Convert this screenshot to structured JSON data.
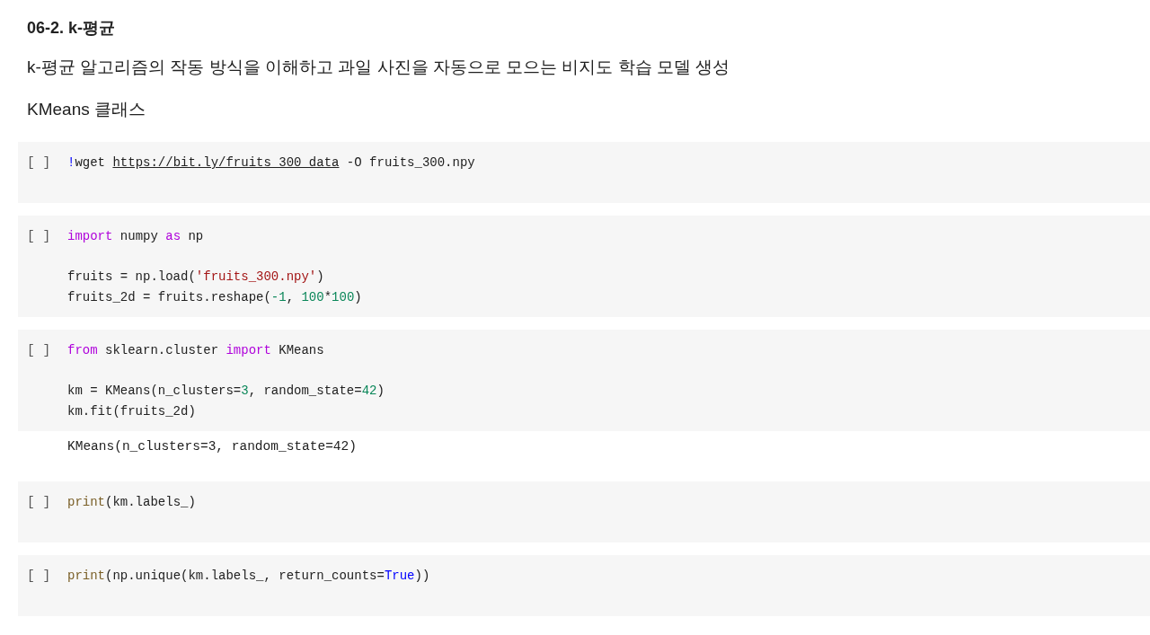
{
  "heading": "06-2. k-평균",
  "subtitle": "k-평균 알고리즘의 작동 방식을 이해하고 과일 사진을 자동으로 모으는 비지도 학습 모델 생성",
  "section": "KMeans 클래스",
  "cells": [
    {
      "prompt": "[ ]",
      "blocks": [
        [
          [
            {
              "kind": "magic",
              "text": "!"
            },
            {
              "kind": "plain",
              "text": "wget "
            },
            {
              "kind": "link",
              "text": "https://bit.ly/fruits_300_data"
            },
            {
              "kind": "plain",
              "text": " -O fruits_300.npy"
            }
          ]
        ]
      ]
    },
    {
      "prompt": "[ ]",
      "blocks": [
        [
          [
            {
              "kind": "keyword",
              "text": "import"
            },
            {
              "kind": "plain",
              "text": " numpy "
            },
            {
              "kind": "keyword",
              "text": "as"
            },
            {
              "kind": "plain",
              "text": " np"
            }
          ]
        ],
        [
          [
            {
              "kind": "plain",
              "text": "fruits = np.load("
            },
            {
              "kind": "string",
              "text": "'fruits_300.npy'"
            },
            {
              "kind": "plain",
              "text": ")"
            }
          ],
          [
            {
              "kind": "plain",
              "text": "fruits_2d = fruits.reshape("
            },
            {
              "kind": "number",
              "text": "-1"
            },
            {
              "kind": "plain",
              "text": ", "
            },
            {
              "kind": "number",
              "text": "100"
            },
            {
              "kind": "plain",
              "text": "*"
            },
            {
              "kind": "number",
              "text": "100"
            },
            {
              "kind": "plain",
              "text": ")"
            }
          ]
        ]
      ]
    },
    {
      "prompt": "[ ]",
      "blocks": [
        [
          [
            {
              "kind": "keyword",
              "text": "from"
            },
            {
              "kind": "plain",
              "text": " sklearn.cluster "
            },
            {
              "kind": "keyword",
              "text": "import"
            },
            {
              "kind": "plain",
              "text": " KMeans"
            }
          ]
        ],
        [
          [
            {
              "kind": "plain",
              "text": "km = KMeans(n_clusters="
            },
            {
              "kind": "number",
              "text": "3"
            },
            {
              "kind": "plain",
              "text": ", random_state="
            },
            {
              "kind": "number",
              "text": "42"
            },
            {
              "kind": "plain",
              "text": ")"
            }
          ],
          [
            {
              "kind": "plain",
              "text": "km.fit(fruits_2d)"
            }
          ]
        ]
      ],
      "output": [
        "KMeans(n_clusters=3, random_state=42)"
      ]
    },
    {
      "prompt": "[ ]",
      "blocks": [
        [
          [
            {
              "kind": "builtin",
              "text": "print"
            },
            {
              "kind": "plain",
              "text": "(km.labels_)"
            }
          ]
        ]
      ]
    },
    {
      "prompt": "[ ]",
      "blocks": [
        [
          [
            {
              "kind": "builtin",
              "text": "print"
            },
            {
              "kind": "plain",
              "text": "(np.unique(km.labels_, return_counts="
            },
            {
              "kind": "constant",
              "text": "True"
            },
            {
              "kind": "plain",
              "text": "))"
            }
          ]
        ]
      ]
    }
  ]
}
